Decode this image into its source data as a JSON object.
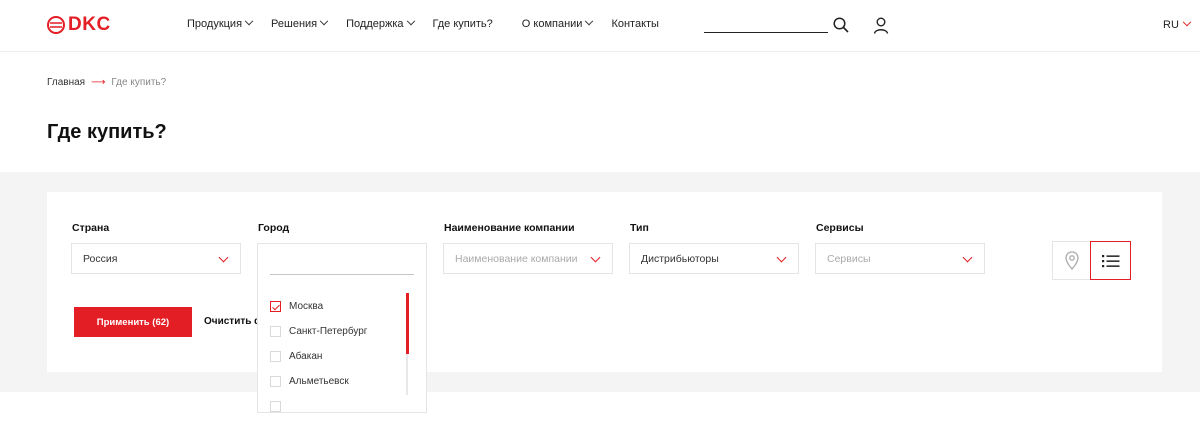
{
  "header": {
    "logo_text": "DKC",
    "nav": [
      {
        "label": "Продукция",
        "dropdown": true
      },
      {
        "label": "Решения",
        "dropdown": true
      },
      {
        "label": "Поддержка",
        "dropdown": true
      },
      {
        "label": "Где купить?",
        "dropdown": false
      },
      {
        "label": "О компании",
        "dropdown": true
      },
      {
        "label": "Контакты",
        "dropdown": false
      }
    ],
    "search_value": "",
    "language": "RU"
  },
  "breadcrumb": {
    "home": "Главная",
    "arrow": "⟶",
    "current": "Где купить?"
  },
  "page_title": "Где купить?",
  "filters": {
    "country": {
      "label": "Страна",
      "value": "Россия"
    },
    "city": {
      "label": "Город",
      "search_value": ""
    },
    "company": {
      "label": "Наименование компании",
      "placeholder": "Наименование компании"
    },
    "type": {
      "label": "Тип",
      "value": "Дистрибьюторы"
    },
    "services": {
      "label": "Сервисы",
      "placeholder": "Сервисы"
    }
  },
  "city_options": [
    {
      "label": "Москва",
      "checked": true
    },
    {
      "label": "Санкт-Петербург",
      "checked": false
    },
    {
      "label": "Абакан",
      "checked": false
    },
    {
      "label": "Альметьевск",
      "checked": false
    }
  ],
  "actions": {
    "apply_label": "Применить (62)",
    "clear_label": "Очистить ф"
  },
  "colors": {
    "accent": "#e31e24",
    "band_bg": "#f4f4f4"
  },
  "icons": {
    "search": "search-icon",
    "user": "user-icon",
    "map_view": "map-pin-icon",
    "list_view": "list-icon"
  }
}
